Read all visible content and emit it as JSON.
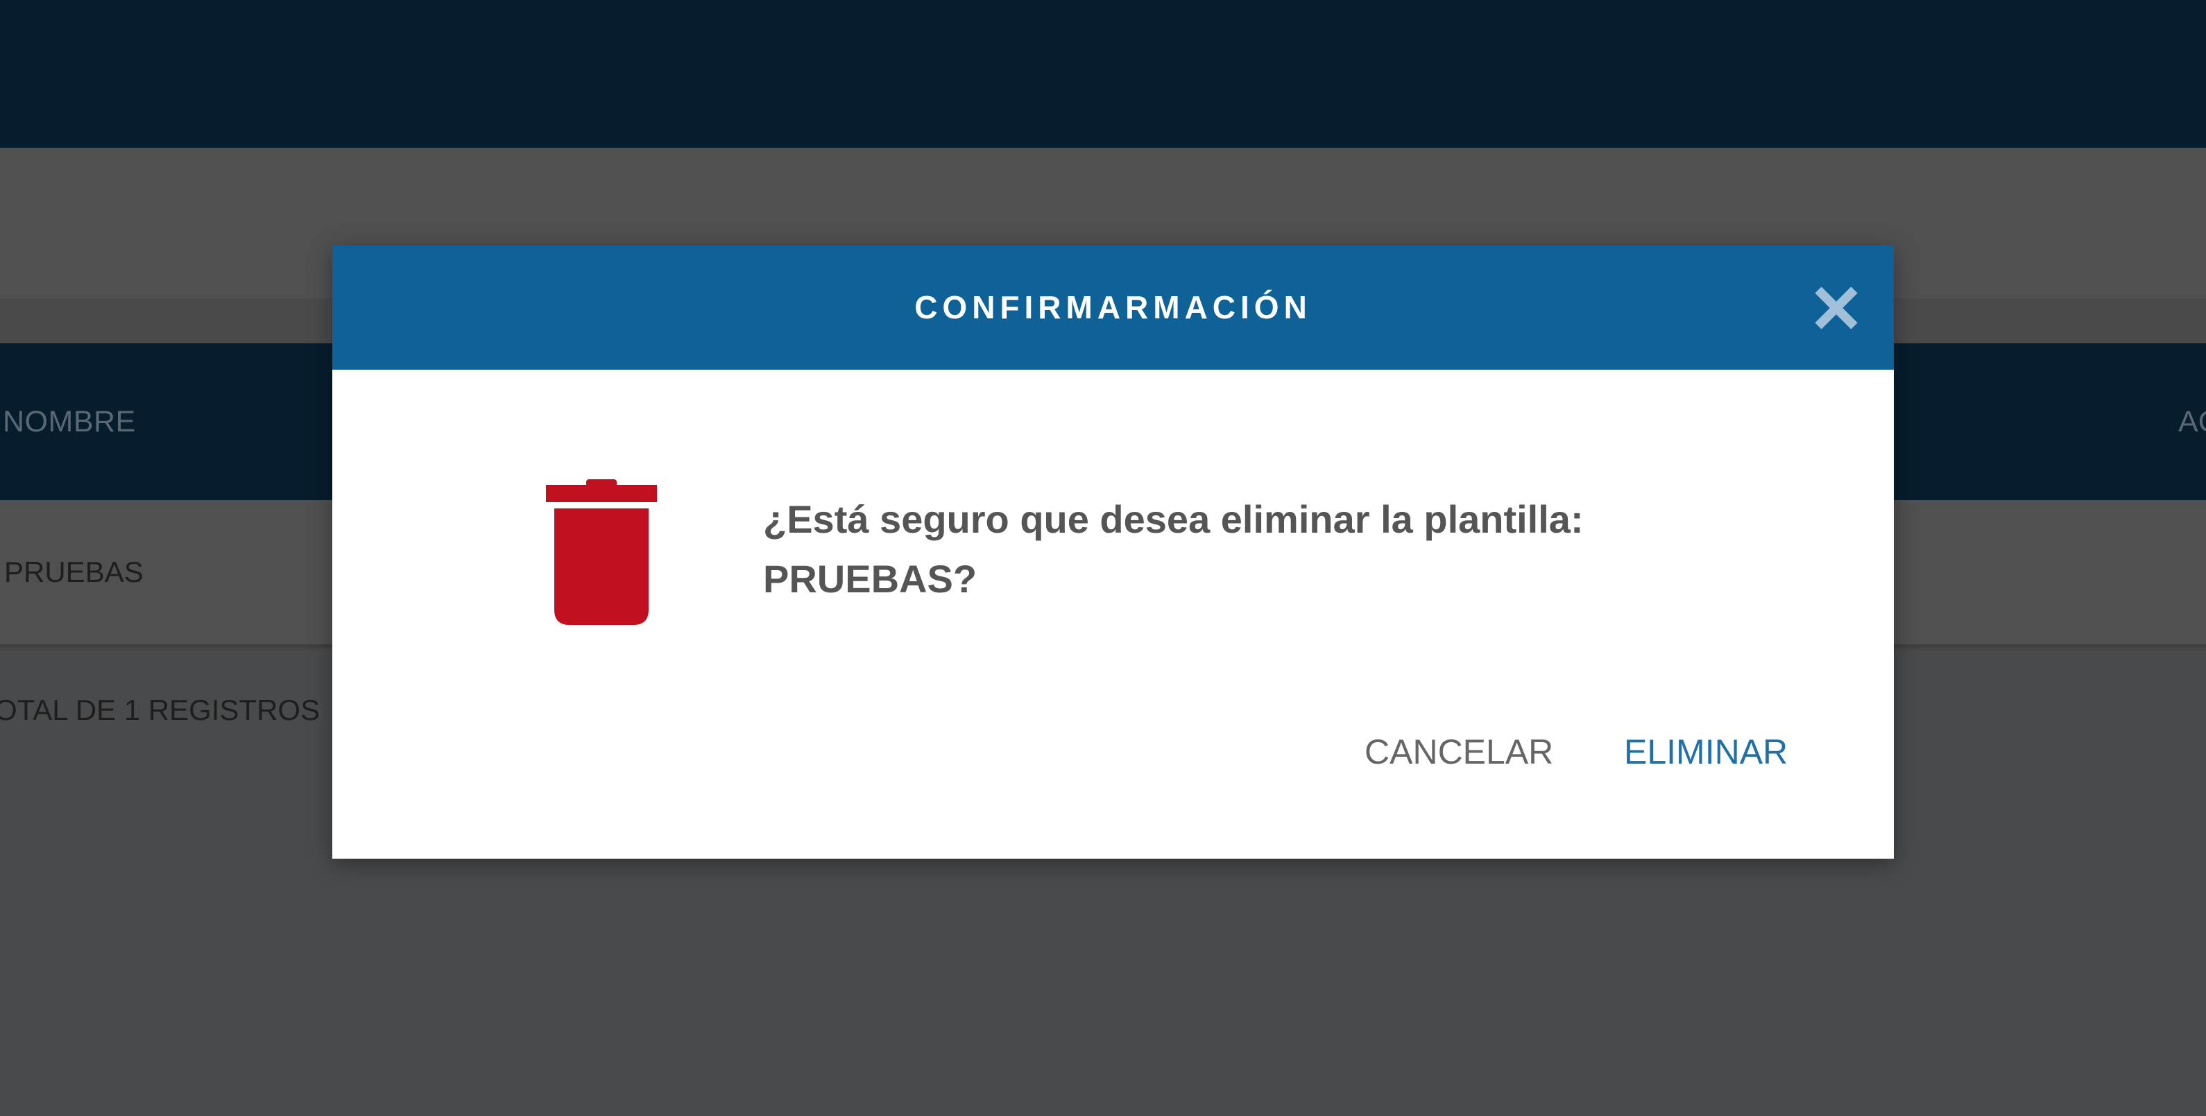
{
  "background": {
    "table": {
      "header_name": "NOMBRE",
      "header_actions": "AC",
      "rows": [
        {
          "name": "PRUEBAS"
        }
      ],
      "total_text": "OTAL DE 1 REGISTROS"
    }
  },
  "dialog": {
    "title": "CONFIRMARMACIÓN",
    "message_line1": "¿Está seguro que desea eliminar la plantilla:",
    "message_line2": "PRUEBAS?",
    "cancel_label": "CANCELAR",
    "delete_label": "ELIMINAR",
    "icon": "trash-icon",
    "close_icon": "close-icon"
  },
  "colors": {
    "header_bg": "#0e6297",
    "topbar_bg": "#061d2d",
    "trash_red": "#c0101f",
    "primary_text": "#1f70a8"
  }
}
